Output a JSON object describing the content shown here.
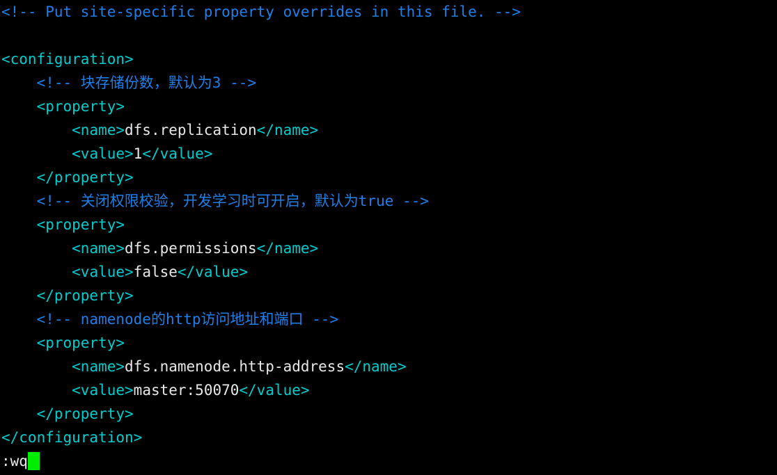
{
  "terminal": {
    "background_color": "#000000",
    "comment_color": "#1e7fe8",
    "tag_color": "#00cdcd",
    "text_color": "#e8e8e8",
    "cursor_color": "#00ee00"
  },
  "editor": {
    "mode_line": ":wq",
    "cursor_glyph": " "
  },
  "document": {
    "lines": [
      {
        "comment": "<!-- Put site-specific property overrides in this file. -->"
      },
      {
        "blank": " "
      },
      {
        "tag_open": "<configuration>"
      },
      {
        "indent": "    ",
        "comment": "<!-- 块存储份数，默认为3 -->"
      },
      {
        "indent": "    ",
        "tag_open": "<property>"
      },
      {
        "indent": "        ",
        "tag_open": "<name>",
        "text": "dfs.replication",
        "tag_close": "</name>"
      },
      {
        "indent": "        ",
        "tag_open": "<value>",
        "text": "1",
        "tag_close": "</value>"
      },
      {
        "indent": "    ",
        "tag_close": "</property>"
      },
      {
        "indent": "    ",
        "comment": "<!-- 关闭权限校验，开发学习时可开启，默认为true -->"
      },
      {
        "indent": "    ",
        "tag_open": "<property>"
      },
      {
        "indent": "        ",
        "tag_open": "<name>",
        "text": "dfs.permissions",
        "tag_close": "</name>"
      },
      {
        "indent": "        ",
        "tag_open": "<value>",
        "text": "false",
        "tag_close": "</value>"
      },
      {
        "indent": "    ",
        "tag_close": "</property>"
      },
      {
        "indent": "    ",
        "comment": "<!-- namenode的http访问地址和端口 -->"
      },
      {
        "indent": "    ",
        "tag_open": "<property>"
      },
      {
        "indent": "        ",
        "tag_open": "<name>",
        "text": "dfs.namenode.http-address",
        "tag_close": "</name>"
      },
      {
        "indent": "        ",
        "tag_open": "<value>",
        "text": "master:50070",
        "tag_close": "</value>"
      },
      {
        "indent": "    ",
        "tag_close": "</property>"
      },
      {
        "tag_close": "</configuration>"
      }
    ]
  }
}
